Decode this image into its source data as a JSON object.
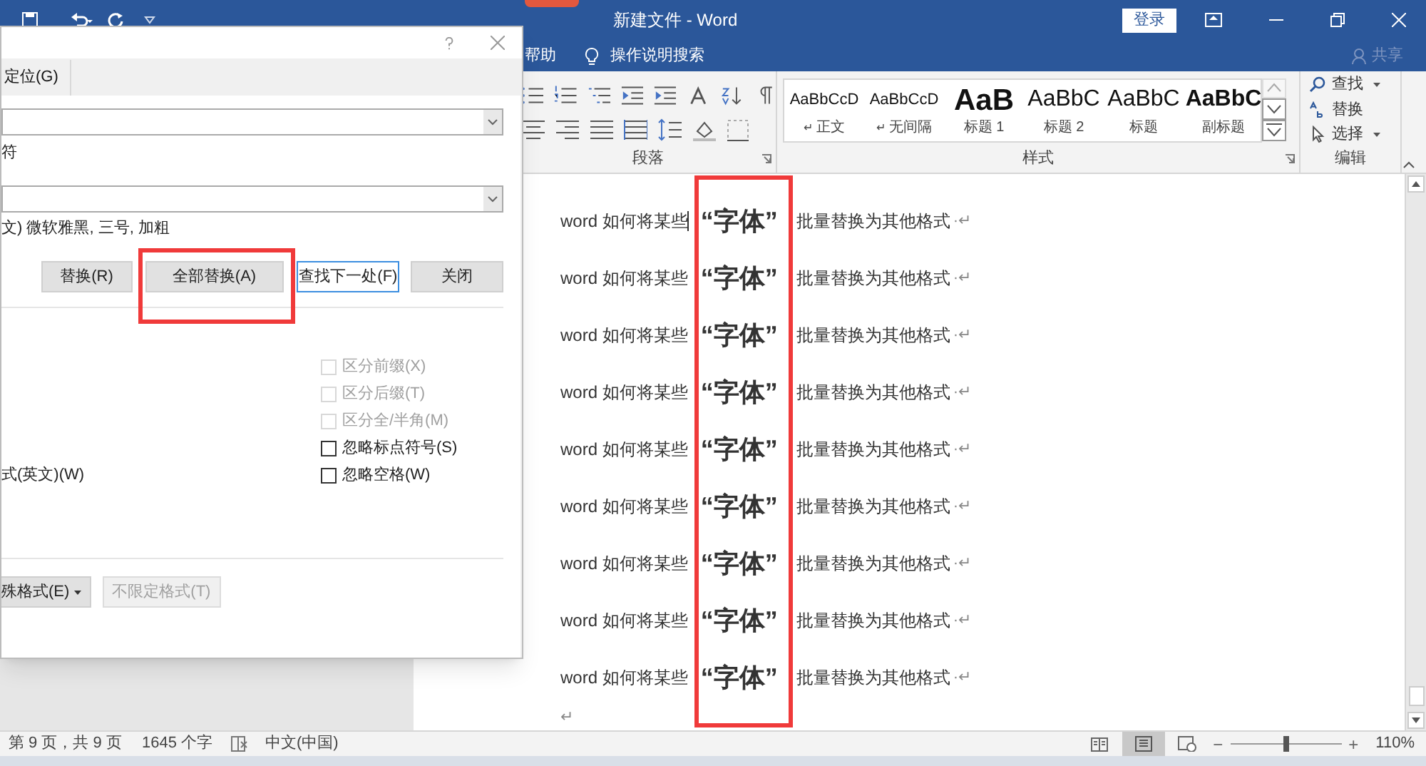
{
  "window": {
    "title": "新建文件 - Word",
    "sign_in": "登录"
  },
  "ribbon_tabs": {
    "help": "帮助",
    "tell_me": "操作说明搜索",
    "share": "共享"
  },
  "ribbon": {
    "groups": [
      "段落",
      "样式",
      "编辑"
    ],
    "styles": [
      {
        "preview": "AaBbCcD",
        "label": "正文",
        "mark": "↵",
        "kind": "small"
      },
      {
        "preview": "AaBbCcD",
        "label": "无间隔",
        "mark": "↵",
        "kind": "small"
      },
      {
        "preview": "AaB",
        "label": "标题 1",
        "kind": "huge"
      },
      {
        "preview": "AaBbC",
        "label": "标题 2",
        "kind": "medium"
      },
      {
        "preview": "AaBbC",
        "label": "标题",
        "kind": "medium"
      },
      {
        "preview": "AaBbC",
        "label": "副标题",
        "kind": "bold"
      }
    ],
    "editing": [
      {
        "label": "查找",
        "kind": "find",
        "dropdown": true
      },
      {
        "label": "替换",
        "kind": "replace",
        "dropdown": false
      },
      {
        "label": "选择",
        "kind": "select",
        "dropdown": true
      }
    ]
  },
  "dialog": {
    "tab": "定位(G)",
    "find_note": "符",
    "format_note": "文) 微软雅黑, 三号, 加粗",
    "buttons": [
      {
        "label": "替换(R)",
        "focused": false
      },
      {
        "label": "全部替换(A)",
        "focused": false
      },
      {
        "label": "查找下一处(F)",
        "focused": true
      },
      {
        "label": "关闭",
        "focused": false
      }
    ],
    "left_option": "式(英文)(W)",
    "options": [
      {
        "label": "区分前缀(X)",
        "checked": false,
        "disabled": true
      },
      {
        "label": "区分后缀(T)",
        "checked": false,
        "disabled": true
      },
      {
        "label": "区分全/半角(M)",
        "checked": false,
        "disabled": true
      },
      {
        "label": "忽略标点符号(S)",
        "checked": false,
        "disabled": false
      },
      {
        "label": "忽略空格(W)",
        "checked": false,
        "disabled": false
      }
    ],
    "bottom_buttons": [
      {
        "label": "殊格式(E)",
        "dropdown": true,
        "disabled": false
      },
      {
        "label": "不限定格式(T)",
        "dropdown": false,
        "disabled": true
      }
    ]
  },
  "document": {
    "lines": [
      {
        "lead": "word 如何将某些",
        "keyword": "“字体”",
        "tail": "批量替换为其他格式",
        "mark": "·↵",
        "cursor": true
      },
      {
        "lead": "word 如何将某些",
        "keyword": "“字体”",
        "tail": "批量替换为其他格式",
        "mark": "·↵",
        "cursor": false
      },
      {
        "lead": "word 如何将某些",
        "keyword": "“字体”",
        "tail": "批量替换为其他格式",
        "mark": "·↵",
        "cursor": false
      },
      {
        "lead": "word 如何将某些",
        "keyword": "“字体”",
        "tail": "批量替换为其他格式",
        "mark": "·↵",
        "cursor": false
      },
      {
        "lead": "word 如何将某些",
        "keyword": "“字体”",
        "tail": "批量替换为其他格式",
        "mark": "·↵",
        "cursor": false
      },
      {
        "lead": "word 如何将某些",
        "keyword": "“字体”",
        "tail": "批量替换为其他格式",
        "mark": "·↵",
        "cursor": false
      },
      {
        "lead": "word 如何将某些",
        "keyword": "“字体”",
        "tail": "批量替换为其他格式",
        "mark": "·↵",
        "cursor": false
      },
      {
        "lead": "word 如何将某些",
        "keyword": "“字体”",
        "tail": "批量替换为其他格式",
        "mark": "·↵",
        "cursor": false
      },
      {
        "lead": "word 如何将某些",
        "keyword": "“字体”",
        "tail": "批量替换为其他格式",
        "mark": "·↵",
        "cursor": false
      }
    ],
    "end_mark": "↵"
  },
  "status_bar": {
    "page": "第 9 页，共 9 页",
    "words": "1645 个字",
    "language": "中文(中国)",
    "zoom": "110%",
    "zoom_slider": {
      "level": 0.5
    },
    "zoom_minus": "−",
    "zoom_plus": "+"
  }
}
